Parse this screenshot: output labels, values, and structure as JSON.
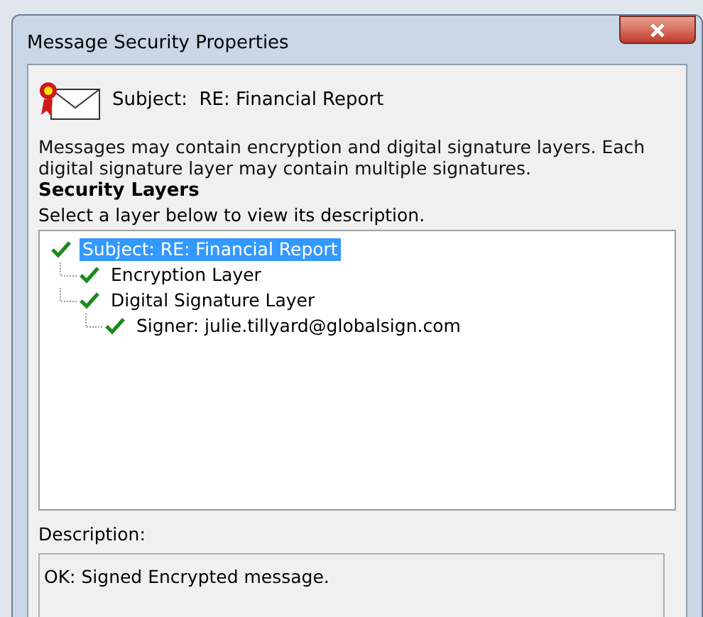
{
  "window": {
    "title": "Message Security Properties"
  },
  "subject": {
    "label": "Subject:",
    "value": "RE: Financial Report"
  },
  "intro": "Messages may contain encryption and digital signature layers. Each digital signature layer may contain multiple signatures.",
  "security_layers": {
    "heading": "Security Layers",
    "instruction": "Select a layer below to view its description.",
    "tree": [
      {
        "label": "Subject: RE: Financial Report",
        "valid": true,
        "selected": true,
        "children": [
          {
            "label": "Encryption Layer",
            "valid": true,
            "selected": false
          },
          {
            "label": "Digital Signature Layer",
            "valid": true,
            "selected": false,
            "children": [
              {
                "label": "Signer: julie.tillyard@globalsign.com",
                "valid": true,
                "selected": false
              }
            ]
          }
        ]
      }
    ]
  },
  "description": {
    "label": "Description:",
    "value": "OK: Signed Encrypted message."
  }
}
